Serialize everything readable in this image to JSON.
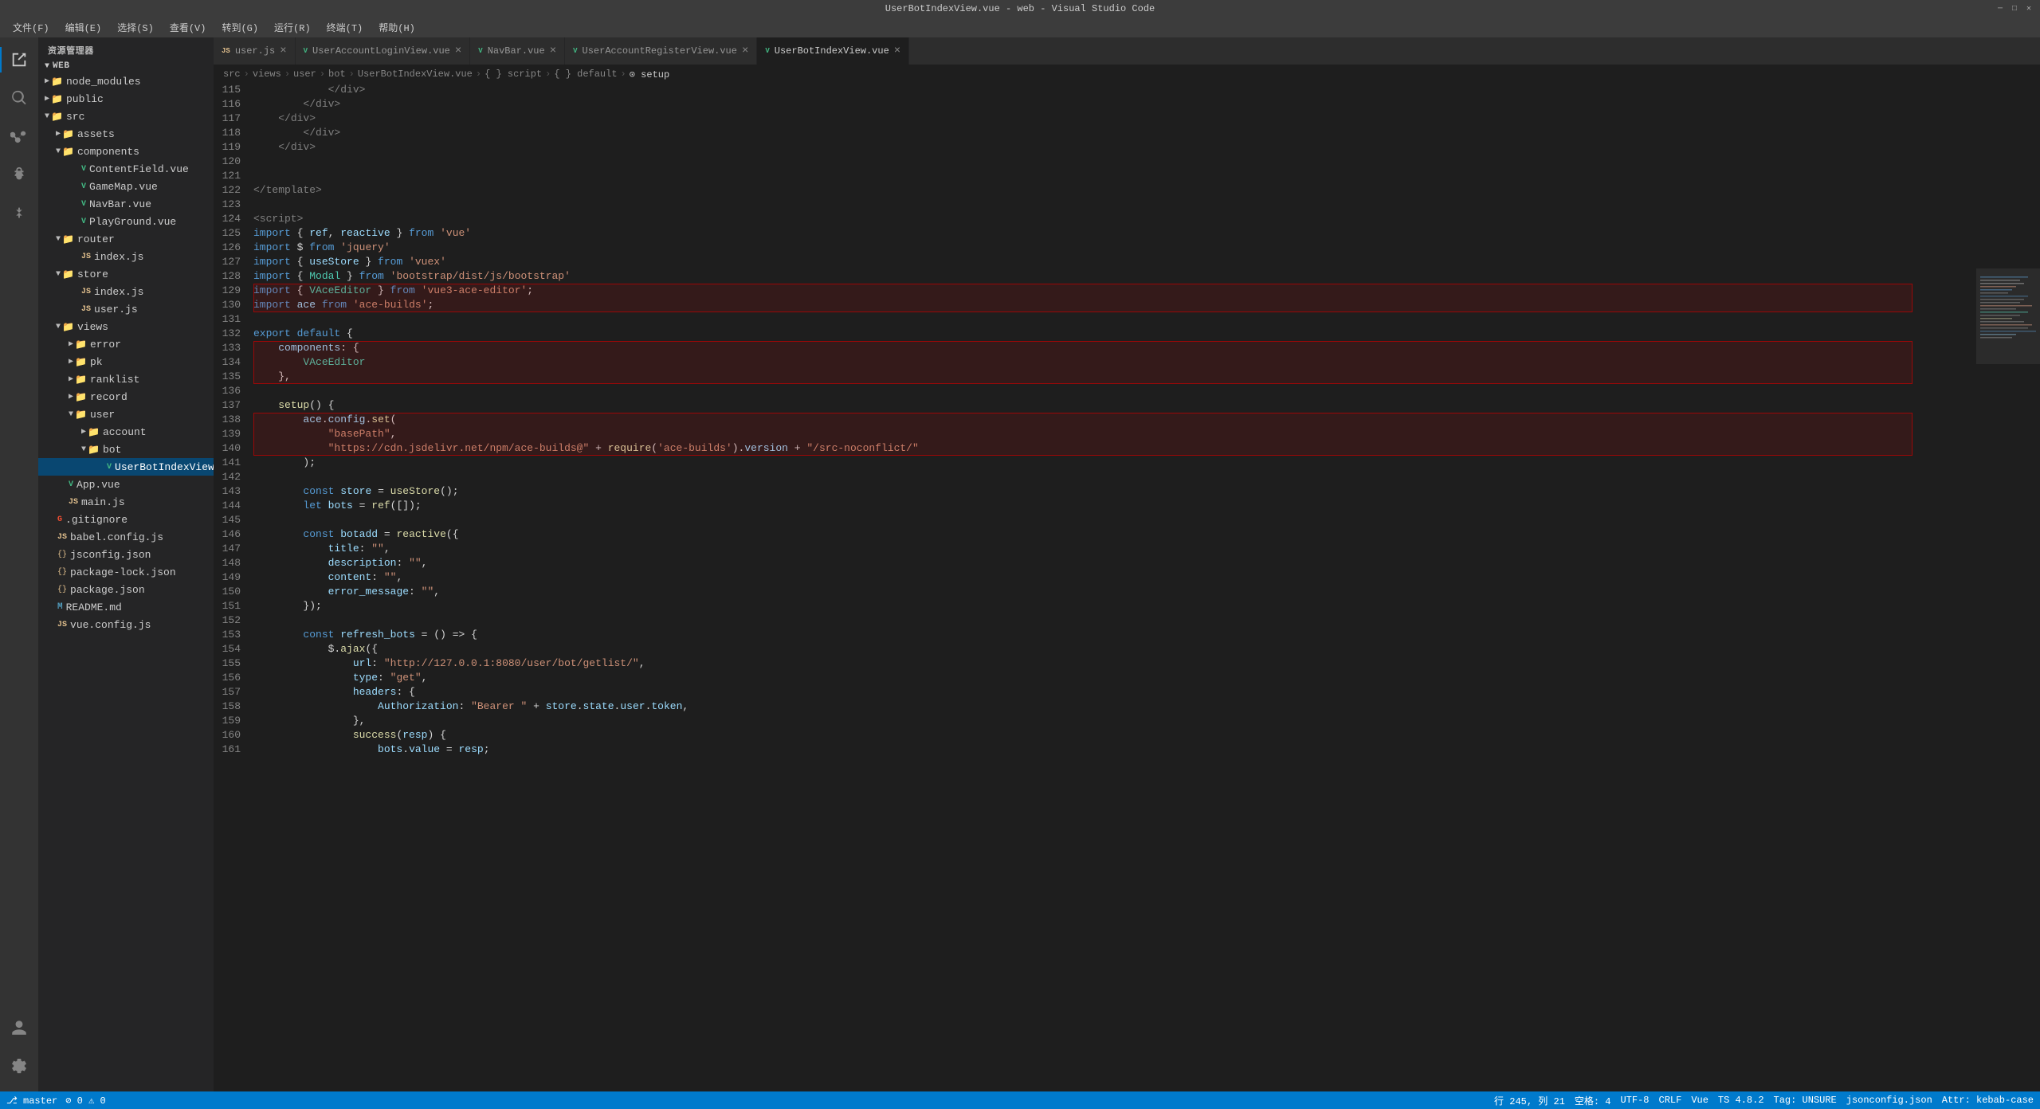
{
  "titleBar": {
    "title": "UserBotIndexView.vue - web - Visual Studio Code"
  },
  "menuBar": {
    "items": [
      "文件(F)",
      "编辑(E)",
      "选择(S)",
      "查看(V)",
      "转到(G)",
      "运行(R)",
      "终端(T)",
      "帮助(H)"
    ]
  },
  "tabs": [
    {
      "id": "user-js",
      "label": "user.js",
      "type": "js",
      "active": false,
      "modified": false
    },
    {
      "id": "login-vue",
      "label": "UserAccountLoginView.vue",
      "type": "vue",
      "active": false,
      "modified": false
    },
    {
      "id": "navbar-vue",
      "label": "NavBar.vue",
      "type": "vue",
      "active": false,
      "modified": false
    },
    {
      "id": "register-vue",
      "label": "UserAccountRegisterView.vue",
      "type": "vue",
      "active": false,
      "modified": false
    },
    {
      "id": "botindex-vue",
      "label": "UserBotIndexView.vue",
      "type": "vue",
      "active": true,
      "modified": false
    }
  ],
  "breadcrumb": {
    "parts": [
      "src",
      "views",
      "user",
      "bot",
      "UserBotIndexView.vue",
      "{ } script",
      "{ } default",
      "⊙ setup"
    ]
  },
  "sidebar": {
    "title": "资源管理器",
    "rootLabel": "WEB",
    "tree": [
      {
        "indent": 0,
        "label": "node_modules",
        "type": "folder",
        "expanded": false
      },
      {
        "indent": 0,
        "label": "public",
        "type": "folder",
        "expanded": false
      },
      {
        "indent": 1,
        "label": "assets",
        "type": "folder",
        "expanded": false
      },
      {
        "indent": 1,
        "label": "components",
        "type": "folder",
        "expanded": true
      },
      {
        "indent": 2,
        "label": "ContentField.vue",
        "type": "vue"
      },
      {
        "indent": 2,
        "label": "GameMap.vue",
        "type": "vue"
      },
      {
        "indent": 2,
        "label": "NavBar.vue",
        "type": "vue"
      },
      {
        "indent": 2,
        "label": "PlayGround.vue",
        "type": "vue"
      },
      {
        "indent": 1,
        "label": "router",
        "type": "folder",
        "expanded": true
      },
      {
        "indent": 2,
        "label": "index.js",
        "type": "js"
      },
      {
        "indent": 1,
        "label": "store",
        "type": "folder",
        "expanded": true
      },
      {
        "indent": 2,
        "label": "index.js",
        "type": "js"
      },
      {
        "indent": 2,
        "label": "user.js",
        "type": "js"
      },
      {
        "indent": 1,
        "label": "views",
        "type": "folder",
        "expanded": true
      },
      {
        "indent": 2,
        "label": "error",
        "type": "folder",
        "expanded": false
      },
      {
        "indent": 2,
        "label": "pk",
        "type": "folder",
        "expanded": false
      },
      {
        "indent": 2,
        "label": "ranklist",
        "type": "folder",
        "expanded": false
      },
      {
        "indent": 2,
        "label": "record",
        "type": "folder",
        "expanded": false
      },
      {
        "indent": 2,
        "label": "user",
        "type": "folder",
        "expanded": true
      },
      {
        "indent": 3,
        "label": "account",
        "type": "folder",
        "expanded": false
      },
      {
        "indent": 3,
        "label": "bot",
        "type": "folder",
        "expanded": true
      },
      {
        "indent": 4,
        "label": "UserBotIndexView.vue",
        "type": "vue",
        "active": true
      },
      {
        "indent": 0,
        "label": "App.vue",
        "type": "vue"
      },
      {
        "indent": 0,
        "label": "main.js",
        "type": "js"
      },
      {
        "indent": 0,
        "label": ".gitignore",
        "type": "git"
      },
      {
        "indent": 0,
        "label": "babel.config.js",
        "type": "js"
      },
      {
        "indent": 0,
        "label": "jsconfig.json",
        "type": "json"
      },
      {
        "indent": 0,
        "label": "package-lock.json",
        "type": "json"
      },
      {
        "indent": 0,
        "label": "package.json",
        "type": "json"
      },
      {
        "indent": 0,
        "label": "README.md",
        "type": "md"
      },
      {
        "indent": 0,
        "label": "vue.config.js",
        "type": "js"
      }
    ]
  },
  "editor": {
    "lines": [
      {
        "num": 115,
        "content": "            </div>"
      },
      {
        "num": 116,
        "content": "        </div>"
      },
      {
        "num": 117,
        "content": "    </div>"
      },
      {
        "num": 118,
        "content": "        </div>"
      },
      {
        "num": 119,
        "content": "    </div>"
      },
      {
        "num": 120,
        "content": ""
      },
      {
        "num": 121,
        "content": ""
      },
      {
        "num": 122,
        "content": "</template>"
      },
      {
        "num": 123,
        "content": ""
      },
      {
        "num": 124,
        "content": "<script>"
      },
      {
        "num": 125,
        "content": "import { ref, reactive } from 'vue'"
      },
      {
        "num": 126,
        "content": "import $ from 'jquery'"
      },
      {
        "num": 127,
        "content": "import { useStore } from 'vuex'"
      },
      {
        "num": 128,
        "content": "import { Modal } from 'bootstrap/dist/js/bootstrap'"
      },
      {
        "num": 129,
        "content": "import { VAceEditor } from 'vue3-ace-editor';",
        "highlight": "box1"
      },
      {
        "num": 130,
        "content": "import ace from 'ace-builds';",
        "highlight": "box1"
      },
      {
        "num": 131,
        "content": ""
      },
      {
        "num": 132,
        "content": "export default {"
      },
      {
        "num": 133,
        "content": "    components: {",
        "highlight": "box2"
      },
      {
        "num": 134,
        "content": "        VAceEditor",
        "highlight": "box2"
      },
      {
        "num": 135,
        "content": "    },",
        "highlight": "box2"
      },
      {
        "num": 136,
        "content": ""
      },
      {
        "num": 137,
        "content": "    setup() {"
      },
      {
        "num": 138,
        "content": "        ace.config.set(",
        "highlight": "box3"
      },
      {
        "num": 139,
        "content": "            \"basePath\",",
        "highlight": "box3"
      },
      {
        "num": 140,
        "content": "            \"https://cdn.jsdelivr.net/npm/ace-builds@\" + require('ace-builds').version + \"/src-noconflict/\"",
        "highlight": "box3"
      },
      {
        "num": 141,
        "content": "        );"
      },
      {
        "num": 142,
        "content": ""
      },
      {
        "num": 143,
        "content": "        const store = useStore();"
      },
      {
        "num": 144,
        "content": "        let bots = ref([]);"
      },
      {
        "num": 145,
        "content": ""
      },
      {
        "num": 146,
        "content": "        const botadd = reactive({"
      },
      {
        "num": 147,
        "content": "            title: \"\","
      },
      {
        "num": 148,
        "content": "            description: \"\","
      },
      {
        "num": 149,
        "content": "            content: \"\","
      },
      {
        "num": 150,
        "content": "            error_message: \"\","
      },
      {
        "num": 151,
        "content": "        });"
      },
      {
        "num": 152,
        "content": ""
      },
      {
        "num": 153,
        "content": "        const refresh_bots = () => {"
      },
      {
        "num": 154,
        "content": "            $.ajax({"
      },
      {
        "num": 155,
        "content": "                url: \"http://127.0.0.1:8080/user/bot/getlist/\","
      },
      {
        "num": 156,
        "content": "                type: \"get\","
      },
      {
        "num": 157,
        "content": "                headers: {"
      },
      {
        "num": 158,
        "content": "                    Authorization: \"Bearer \" + store.state.user.token,"
      },
      {
        "num": 159,
        "content": "                },"
      },
      {
        "num": 160,
        "content": "                success(resp) {"
      },
      {
        "num": 161,
        "content": "                    bots.value = resp;"
      }
    ]
  },
  "statusBar": {
    "branch": " master",
    "errors": "0",
    "warnings": "0",
    "line": "行 245",
    "col": "列 21",
    "spaces": "空格: 4",
    "encoding": "UTF-8",
    "lineEnding": "CRLF",
    "language": "Vue",
    "version": "TS 4.8.2",
    "tag": "Tag: UNSURE",
    "schema": "jsonconfig.json",
    "attr": "Attr: kebab-case"
  }
}
